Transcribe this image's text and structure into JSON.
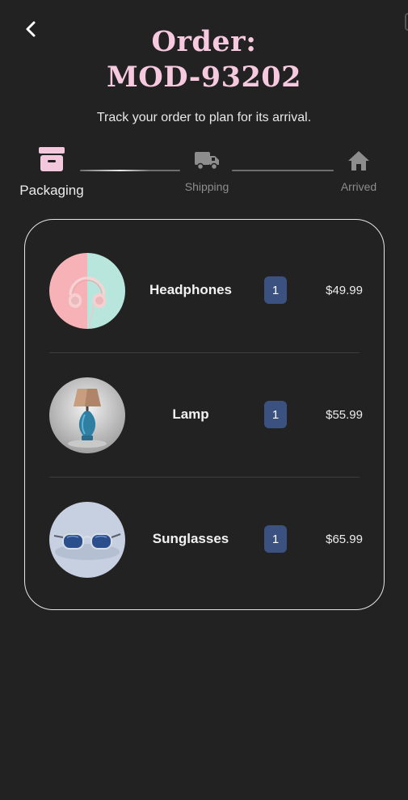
{
  "header": {
    "title_line1": "Order:",
    "title_line2": "MOD-93202",
    "subtitle": "Track your order to plan for its arrival."
  },
  "progress": {
    "current_step": "Packaging",
    "steps": [
      {
        "label": "Packaging",
        "icon": "archive-box-icon",
        "active": true
      },
      {
        "label": "Shipping",
        "icon": "truck-icon",
        "active": false
      },
      {
        "label": "Arrived",
        "icon": "home-icon",
        "active": false
      }
    ]
  },
  "order": {
    "items": [
      {
        "name": "Headphones",
        "quantity": "1",
        "price": "$49.99",
        "image": "headphones-image"
      },
      {
        "name": "Lamp",
        "quantity": "1",
        "price": "$55.99",
        "image": "lamp-image"
      },
      {
        "name": "Sunglasses",
        "quantity": "1",
        "price": "$65.99",
        "image": "sunglasses-image"
      }
    ]
  },
  "colors": {
    "background": "#222222",
    "title": "#f6c9df",
    "active_step_icon": "#f3c8dd",
    "inactive_step": "#8d8d8d",
    "quantity_badge": "#3b5280",
    "card_border": "#e6e6e6"
  }
}
